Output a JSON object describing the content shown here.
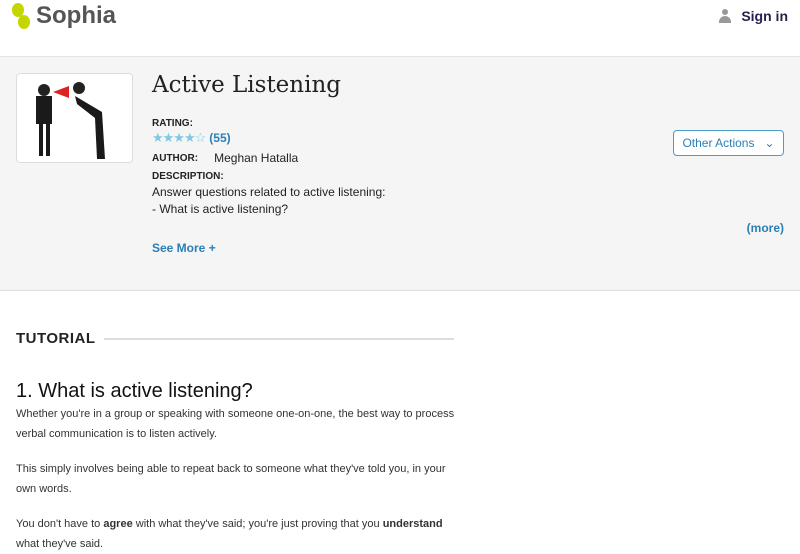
{
  "header": {
    "logo": "Sophia",
    "signin": "Sign in"
  },
  "resource": {
    "title": "Active Listening",
    "rating_label": "RATING:",
    "rating_value": 4.5,
    "rating_count": "(55)",
    "author_label": "AUTHOR:",
    "author": "Meghan Hatalla",
    "description_label": "DESCRIPTION:",
    "description_line1": "Answer questions related to active listening:",
    "description_line2": "- What is active listening?",
    "more": "(more)",
    "see_more": "See More +",
    "other_actions": "Other Actions"
  },
  "tutorial": {
    "section": "TUTORIAL",
    "heading": "1. What is active listening?",
    "p1": "Whether you're in a group or speaking with someone one-on-one, the best way to process verbal communication is to listen actively.",
    "p2": "This simply involves being able to repeat back to someone what they've told you, in your own words.",
    "p3a": "You don't have to ",
    "p3b": "agree",
    "p3c": " with what they've said; you're just proving that you ",
    "p3d": "understand",
    "p3e": " what they've said."
  },
  "colors": {
    "accent": "#2a7fb5",
    "logo": "#c4d600",
    "star": "#7fc8e8"
  }
}
